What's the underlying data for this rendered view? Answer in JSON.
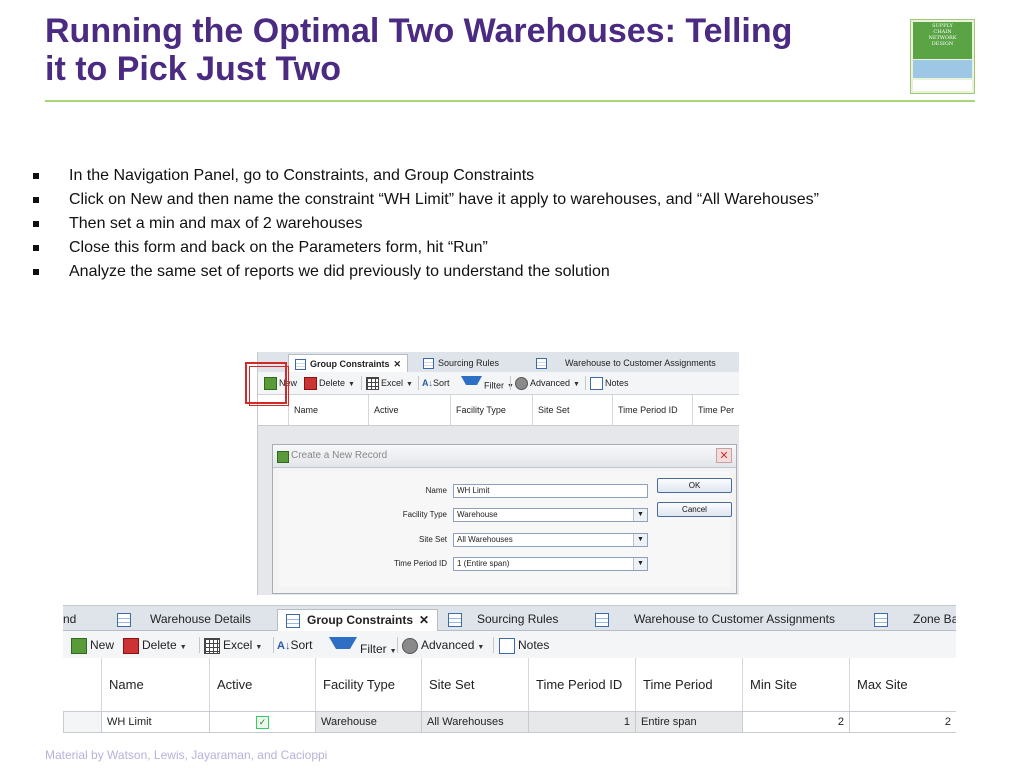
{
  "slide": {
    "title_line1": "Running the Optimal Two Warehouses:  Telling",
    "title_line2": "it to Pick Just Two",
    "logo_lines": [
      "SUPPLY",
      "CHAIN",
      "NETWORK",
      "DESIGN"
    ],
    "footer": "Material by Watson, Lewis, Jayaraman, and Cacioppi"
  },
  "bullets": [
    "In the Navigation Panel, go to Constraints, and Group Constraints",
    "Click on New and then name the constraint “WH Limit” have it apply to warehouses, and “All Warehouses”",
    "Then set a min and max of 2 warehouses",
    "Close this form and back on the Parameters form, hit “Run”",
    "Analyze the same set of reports we did previously to understand the solution"
  ],
  "upper": {
    "tabs": [
      "Group Constraints",
      "Sourcing Rules",
      "Warehouse to Customer Assignments"
    ],
    "toolbar": {
      "new": "New",
      "delete": "Delete",
      "excel": "Excel",
      "sort": "Sort",
      "filter": "Filter",
      "advanced": "Advanced",
      "notes": "Notes"
    },
    "columns": [
      "Name",
      "Active",
      "Facility Type",
      "Site Set",
      "Time Period ID",
      "Time Per"
    ],
    "dialog": {
      "title": "Create a New Record",
      "fields": [
        {
          "label": "Name",
          "value": "WH Limit"
        },
        {
          "label": "Facility Type",
          "value": "Warehouse"
        },
        {
          "label": "Site Set",
          "value": "All Warehouses"
        },
        {
          "label": "Time Period ID",
          "value": "1 (Entire span)"
        }
      ],
      "ok": "OK",
      "cancel": "Cancel"
    }
  },
  "lower": {
    "tabs": [
      "nd",
      "Warehouse Details",
      "Group Constraints",
      "Sourcing Rules",
      "Warehouse to Customer Assignments",
      "Zone Ba"
    ],
    "toolbar": {
      "new": "New",
      "delete": "Delete",
      "excel": "Excel",
      "sort": "Sort",
      "filter": "Filter",
      "advanced": "Advanced",
      "notes": "Notes"
    },
    "columns": [
      "Name",
      "Active",
      "Facility Type",
      "Site Set",
      "Time Period ID",
      "Time Period",
      "Min Site",
      "Max Site"
    ],
    "row": {
      "name": "WH Limit",
      "active": true,
      "facility_type": "Warehouse",
      "site_set": "All Warehouses",
      "time_period_id": "1",
      "time_period": "Entire span",
      "min_site": "2",
      "max_site": "2"
    }
  },
  "colors": {
    "title": "#4b2a82",
    "rule": "#a8d47a",
    "highlight": "#d12a2a",
    "footer": "#b9b1d9"
  }
}
